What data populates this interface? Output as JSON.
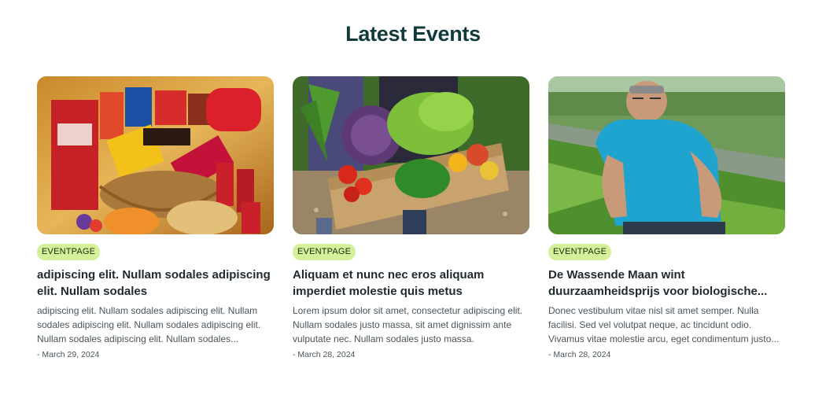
{
  "section": {
    "title": "Latest Events"
  },
  "cards": [
    {
      "image_icon": "snack-basket-photo",
      "badge": "EVENTPAGE",
      "title": "adipiscing elit. Nullam sodales adipiscing elit. Nullam sodales",
      "excerpt": "adipiscing elit. Nullam sodales adipiscing elit. Nullam sodales adipiscing elit. Nullam sodales adipiscing elit. Nullam sodales adipiscing elit. Nullam sodales...",
      "date": "- March 29, 2024"
    },
    {
      "image_icon": "vegetable-crate-photo",
      "badge": "EVENTPAGE",
      "title": "Aliquam et nunc nec eros aliquam imperdiet molestie quis metus",
      "excerpt": "Lorem ipsum dolor sit amet, consectetur adipiscing elit. Nullam sodales justo massa, sit amet dignissim ante vulputate nec. Nullam sodales justo massa.",
      "date": "- March 28, 2024"
    },
    {
      "image_icon": "farmer-in-field-photo",
      "badge": "EVENTPAGE",
      "title": "De Wassende Maan wint duurzaamheidsprijs voor biologische...",
      "excerpt": "Donec vestibulum vitae nisl sit amet semper. Nulla facilisi. Sed vel volutpat neque, ac tincidunt odio. Vivamus vitae molestie arcu, eget condimentum justo...",
      "date": "- March 28, 2024"
    }
  ],
  "colors": {
    "title": "#123a3a",
    "badge_bg": "#d4f09a",
    "text": "#1e2a30",
    "muted": "#4a555b"
  }
}
